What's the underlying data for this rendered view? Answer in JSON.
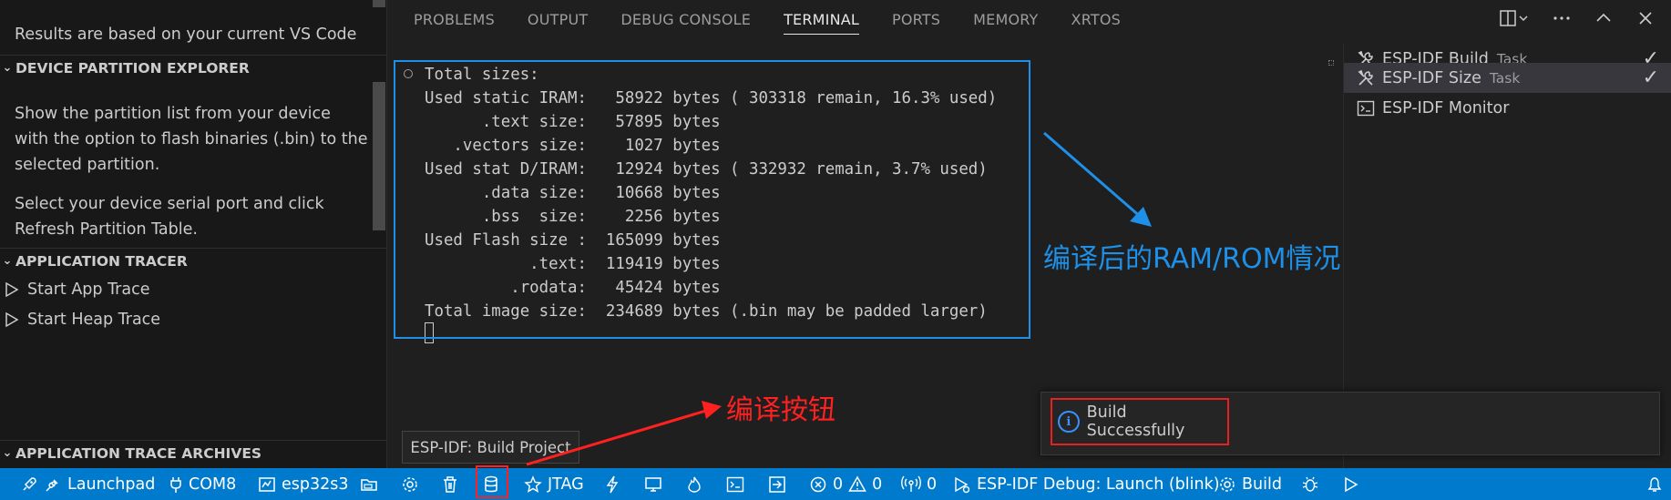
{
  "sidebar": {
    "top_text": "Results are based on your current VS Code",
    "sections": [
      {
        "title": "DEVICE PARTITION EXPLORER"
      },
      {
        "title": "APPLICATION TRACER"
      },
      {
        "title": "APPLICATION TRACE ARCHIVES"
      }
    ],
    "partition_desc_1": "Show the partition list from your device",
    "partition_desc_2": "with the option to flash binaries (.bin) to the",
    "partition_desc_3": "selected partition.",
    "partition_desc_4": "Select your device serial port and click",
    "partition_desc_5": "Refresh Partition Table.",
    "tracer_items": [
      "Start App Trace",
      "Start Heap Trace"
    ]
  },
  "panel": {
    "tabs": [
      "PROBLEMS",
      "OUTPUT",
      "DEBUG CONSOLE",
      "TERMINAL",
      "PORTS",
      "MEMORY",
      "XRTOS"
    ],
    "active_tab": "TERMINAL"
  },
  "terminal": {
    "lines": [
      "Total sizes:",
      "Used static IRAM:   58922 bytes ( 303318 remain, 16.3% used)",
      "      .text size:   57895 bytes",
      "   .vectors size:    1027 bytes",
      "Used stat D/IRAM:   12924 bytes ( 332932 remain, 3.7% used)",
      "      .data size:   10668 bytes",
      "      .bss  size:    2256 bytes",
      "Used Flash size :  165099 bytes",
      "           .text:  119419 bytes",
      "         .rodata:   45424 bytes",
      "Total image size:  234689 bytes (.bin may be padded larger)"
    ]
  },
  "tasks": [
    {
      "label": "ESP-IDF Build",
      "desc": "Task",
      "done": true
    },
    {
      "label": "ESP-IDF Size",
      "desc": "Task",
      "done": true
    },
    {
      "label": "ESP-IDF Monitor",
      "desc": "",
      "done": false
    }
  ],
  "annotations": {
    "size_note": "编译后的RAM/ROM情况",
    "build_note": "编译按钮"
  },
  "notification": {
    "text": "Build Successfully"
  },
  "tooltip": {
    "text": "ESP-IDF: Build Project"
  },
  "statusbar": {
    "launchpad": "Launchpad",
    "port": "COM8",
    "target": "esp32s3",
    "jtag": "JTAG",
    "errors": "0",
    "warnings": "0",
    "ports_count": "0",
    "debug": "ESP-IDF Debug: Launch (blink)",
    "build": "Build"
  },
  "colors": {
    "accent": "#007acc",
    "annotation_blue": "#1e90e8",
    "annotation_red": "#ff2020"
  }
}
